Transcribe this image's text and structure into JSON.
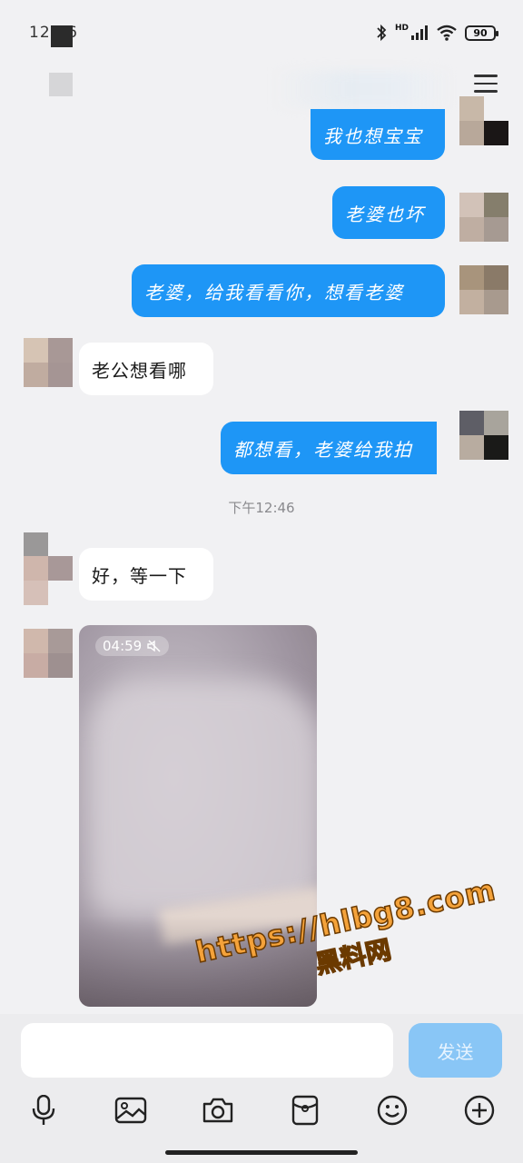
{
  "status_bar": {
    "time": "12:46",
    "network": "HD",
    "battery": "90"
  },
  "header": {
    "menu_icon": "hamburger-menu-icon"
  },
  "messages": [
    {
      "direction": "out",
      "text": "我也想宝宝"
    },
    {
      "direction": "out",
      "text": "老婆也坏"
    },
    {
      "direction": "out",
      "text": "老婆，给我看看你，想看老婆"
    },
    {
      "direction": "in",
      "text": "老公想看哪"
    },
    {
      "direction": "out",
      "text": "都想看，老婆给我拍"
    },
    {
      "direction": "in",
      "text": "好，等一下"
    }
  ],
  "timestamp": "下午12:46",
  "video": {
    "duration": "04:59",
    "muted_icon": "muted-speaker-icon"
  },
  "watermark": {
    "url": "https://hlbg8.com",
    "name": "黑料网"
  },
  "composer": {
    "input_value": "",
    "send_label": "发送"
  },
  "toolbar": {
    "icons": [
      "microphone-icon",
      "image-icon",
      "camera-icon",
      "red-packet-icon",
      "emoji-icon",
      "plus-icon"
    ]
  },
  "colors": {
    "outgoing_bubble": "#1e96f6",
    "incoming_bubble": "#ffffff",
    "background": "#f1f1f3",
    "send_button": "#89c6f6"
  }
}
